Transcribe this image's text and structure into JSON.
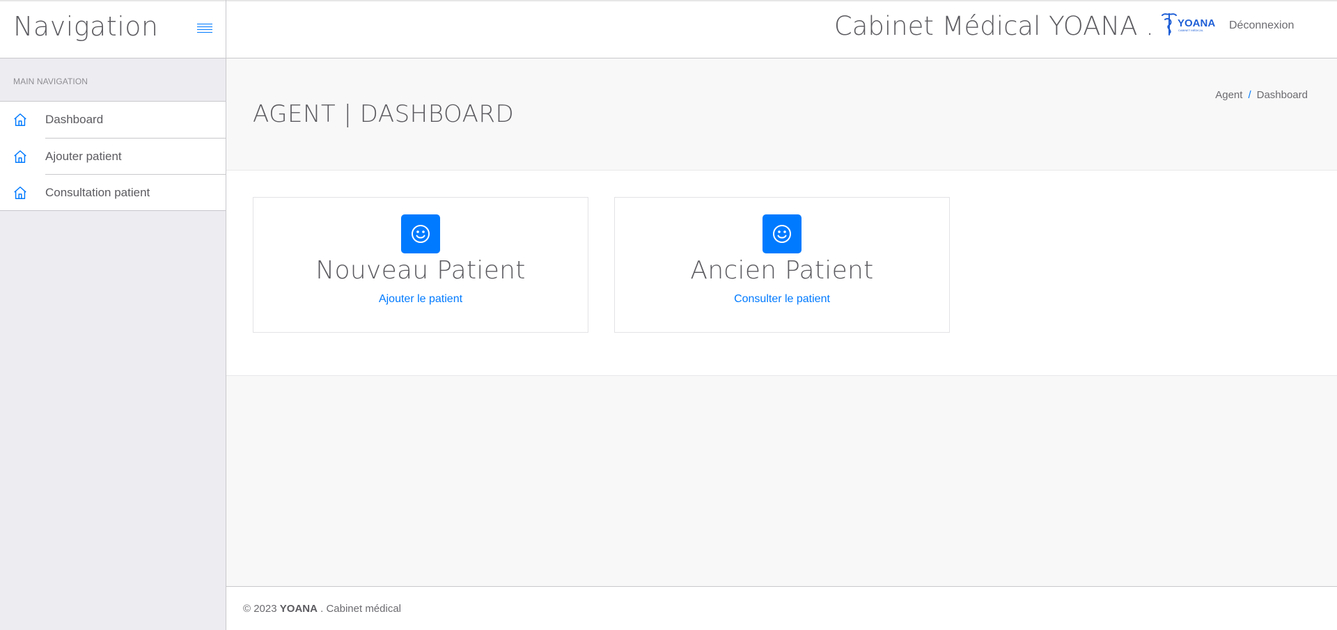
{
  "sidebar": {
    "brand_title": "Navigation",
    "section_heading": "MAIN NAVIGATION",
    "items": [
      {
        "label": "Dashboard",
        "icon": "home-icon"
      },
      {
        "label": "Ajouter patient",
        "icon": "home-icon"
      },
      {
        "label": "Consultation patient",
        "icon": "home-icon"
      }
    ]
  },
  "header": {
    "clinic_title": "Cabinet Médical YOANA .",
    "logo_text": "YOANA",
    "logo_subtext": "CABINET MÉDICAL",
    "logout_label": "Déconnexion"
  },
  "page": {
    "title": "AGENT | DASHBOARD",
    "breadcrumb": [
      "Agent",
      "Dashboard"
    ],
    "breadcrumb_separator": "/"
  },
  "cards": [
    {
      "title": "Nouveau Patient",
      "link": "Ajouter le patient",
      "icon": "smiley-icon"
    },
    {
      "title": "Ancien Patient",
      "link": "Consulter le patient",
      "icon": "smiley-icon"
    }
  ],
  "footer": {
    "copyright": "© 2023",
    "brand": "YOANA",
    "suffix": ". Cabinet médical"
  },
  "colors": {
    "accent": "#007aff",
    "text": "#5b5b60",
    "sidebar_bg": "#ededf1",
    "page_bg": "#f8f8f8"
  }
}
